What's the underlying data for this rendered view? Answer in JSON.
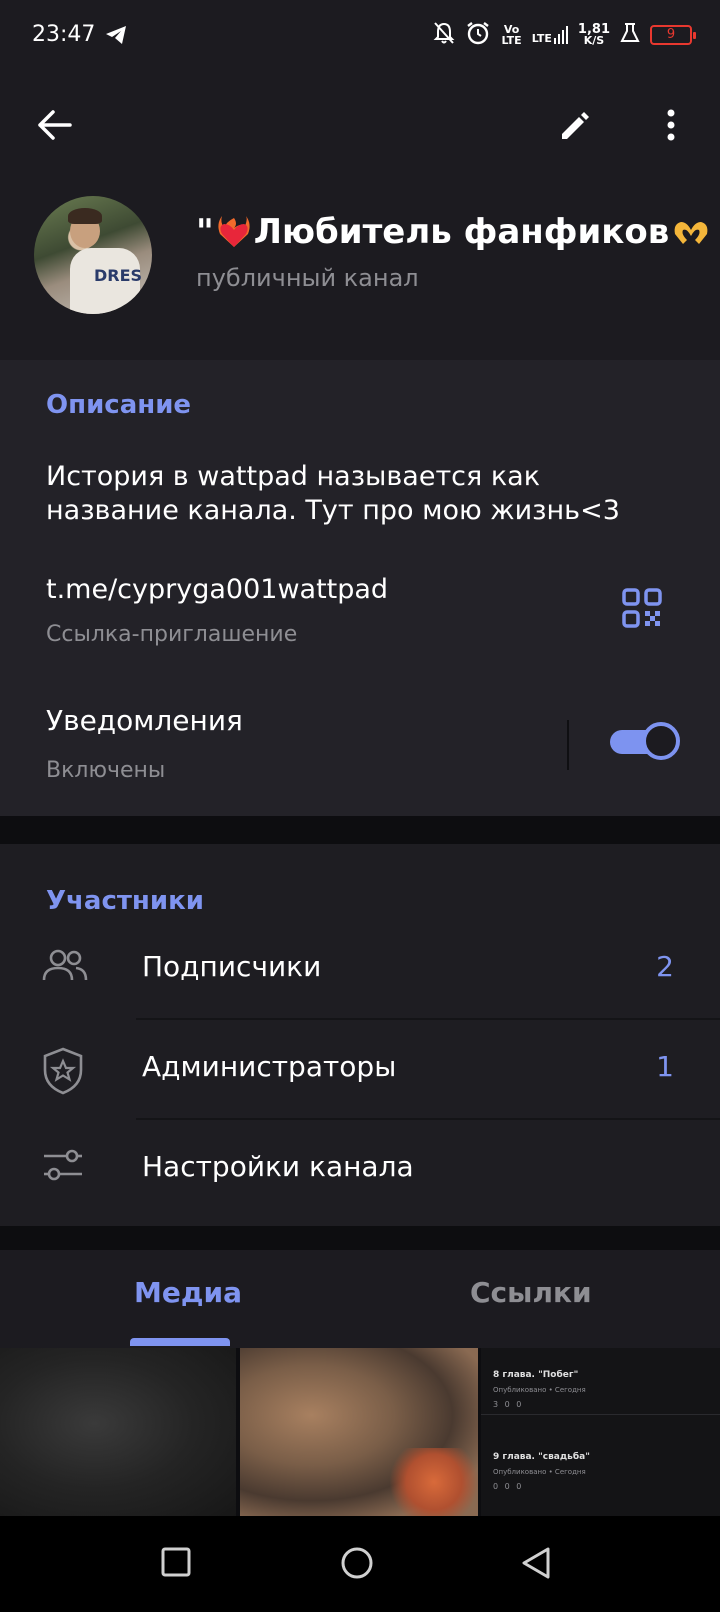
{
  "status_bar": {
    "time": "23:47",
    "network_vo": "Vo",
    "network_lte": "LTE",
    "network_lte2": "LTE",
    "speed_value": "1,81",
    "speed_unit": "K/S",
    "battery": "9"
  },
  "profile": {
    "title_prefix": "\"",
    "title_text": "Любитель фанфиков",
    "subtitle": "публичный канал",
    "avatar_text": "DRES"
  },
  "info": {
    "description_header": "Описание",
    "description": "История в wattpad называется как название канала. Тут про мою жизнь<3",
    "link": "t.me/cypryga001wattpad",
    "link_caption": "Ссылка-приглашение",
    "notifications_label": "Уведомления",
    "notifications_state": "Включены",
    "notifications_on": true
  },
  "members": {
    "header": "Участники",
    "rows": [
      {
        "label": "Подписчики",
        "count": "2",
        "icon": "users-icon"
      },
      {
        "label": "Администраторы",
        "count": "1",
        "icon": "shield-star-icon"
      },
      {
        "label": "Настройки канала",
        "count": "",
        "icon": "sliders-icon"
      }
    ]
  },
  "tabs": [
    {
      "label": "Медиа",
      "active": true
    },
    {
      "label": "Ссылки",
      "active": false
    }
  ],
  "media_posts": [
    {
      "title": "8 глава. \"Побег\"",
      "meta": "Опубликовано • Сегодня",
      "stats": "3 0 0"
    },
    {
      "title": "9 глава. \"свадьба\"",
      "meta": "Опубликовано • Сегодня",
      "stats": "0 0 0"
    }
  ],
  "colors": {
    "accent": "#7f94f0",
    "background": "#1c1b20",
    "muted_text": "#8e8e93"
  }
}
